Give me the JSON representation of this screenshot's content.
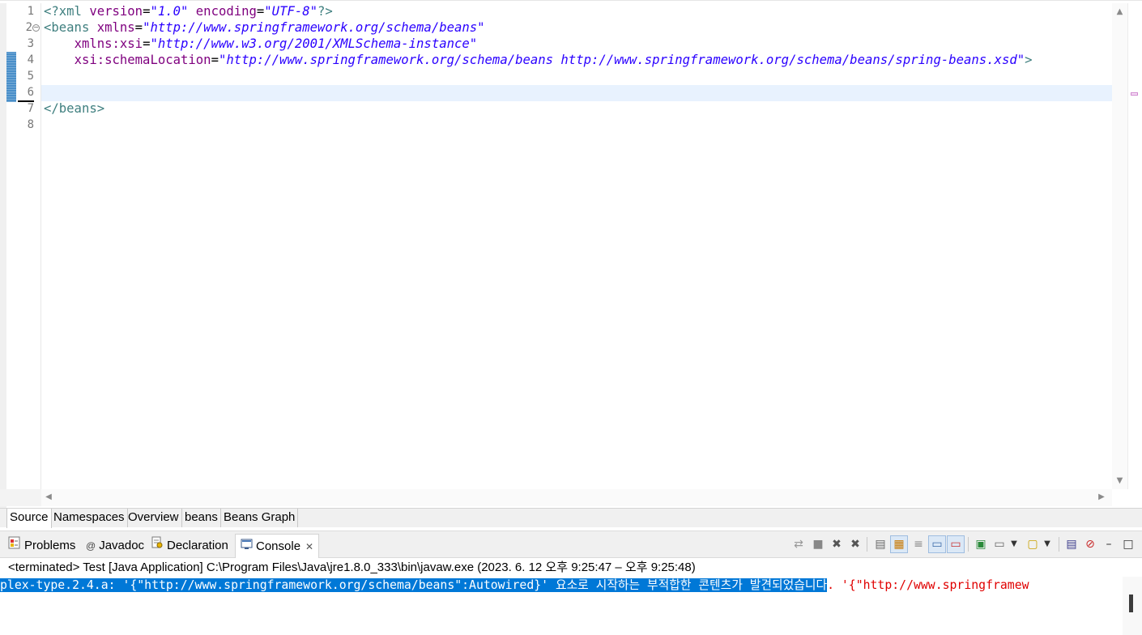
{
  "editor": {
    "line_numbers": [
      "1",
      "2",
      "3",
      "4",
      "5",
      "6",
      "7",
      "8"
    ],
    "lines": {
      "l1": {
        "open": "<?xml ",
        "a1": "version",
        "eq1": "=",
        "v1": "\"1.0\"",
        "sp": " ",
        "a2": "encoding",
        "eq2": "=",
        "v2": "\"UTF-8\"",
        "close": "?>"
      },
      "l2": {
        "tag": "<beans ",
        "attr": "xmlns",
        "eq": "=",
        "val": "\"http://www.springframework.org/schema/beans\""
      },
      "l3": {
        "indent": "    ",
        "attr": "xmlns:xsi",
        "eq": "=",
        "val": "\"http://www.w3.org/2001/XMLSchema-instance\""
      },
      "l4": {
        "indent": "    ",
        "attr": "xsi:schemaLocation",
        "eq": "=",
        "val": "\"http://www.springframework.org/schema/beans http://www.springframework.org/schema/beans/spring-beans.xsd\"",
        "close": ">"
      },
      "l7": {
        "tag": "</beans>"
      }
    }
  },
  "editor_tabs": [
    "Source",
    "Namespaces",
    "Overview",
    "beans",
    "Beans Graph"
  ],
  "panel": {
    "tabs": [
      "Problems",
      "Javadoc",
      "Declaration",
      "Console"
    ],
    "active_tab": "Console",
    "close_glyph": "✕",
    "status": "<terminated> Test [Java Application] C:\\Program Files\\Java\\jre1.8.0_333\\bin\\javaw.exe  (2023. 6. 12 오후 9:25:47 – 오후 9:25:48)",
    "console_selected": "plex-type.2.4.a: '{\"http://www.springframework.org/schema/beans\":Autowired}' 요소로 시작하는 부적합한 콘텐츠가 발견되었습니다",
    "console_rest": ". '{\"http://www.springframew"
  },
  "icons": {
    "problems": "problems-icon",
    "javadoc": "javadoc-icon",
    "declaration": "declaration-icon",
    "console": "console-icon"
  },
  "colors": {
    "tag": "#3f7f7f",
    "attribute": "#7f007f",
    "string": "#2a00ff",
    "current_line": "#e8f2fe",
    "selection": "#0078d7",
    "error_text": "#e00000"
  }
}
